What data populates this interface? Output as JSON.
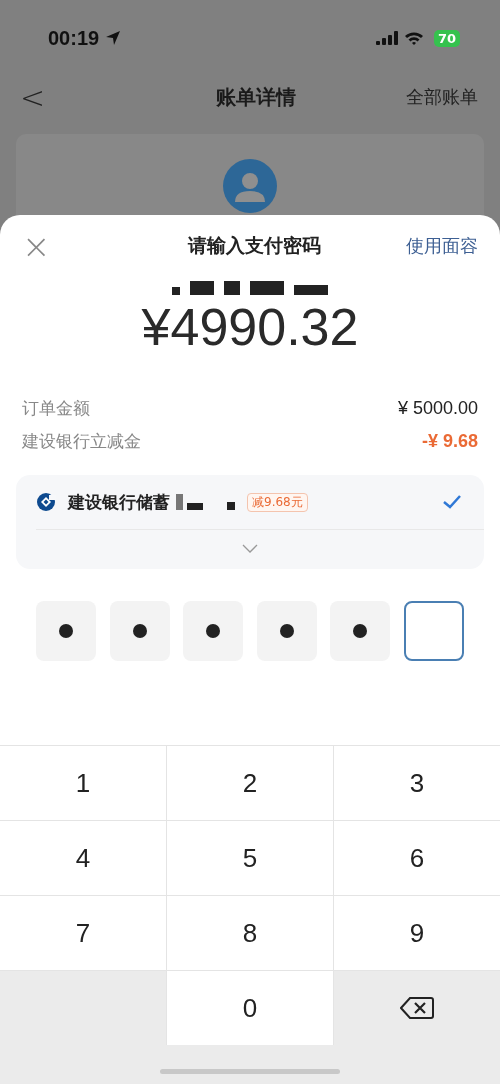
{
  "status_bar": {
    "time": "00:19",
    "battery": "70"
  },
  "nav": {
    "back": "<",
    "title": "账单详情",
    "right": "全部账单"
  },
  "sheet": {
    "close": "×",
    "title": "请输入支付密码",
    "face_id": "使用面容",
    "amount": "¥4990.32",
    "lines": [
      {
        "label": "订单金额",
        "value": "¥ 5000.00",
        "kind": "normal"
      },
      {
        "label": "建设银行立减金",
        "value": "-¥ 9.68",
        "kind": "discount"
      }
    ],
    "payment": {
      "name": "建设银行储蓄",
      "tag": "减9.68元",
      "checked": true
    },
    "pin": [
      {
        "filled": true,
        "selected": false
      },
      {
        "filled": true,
        "selected": false
      },
      {
        "filled": true,
        "selected": false
      },
      {
        "filled": true,
        "selected": false
      },
      {
        "filled": true,
        "selected": false
      },
      {
        "filled": false,
        "selected": true
      }
    ]
  },
  "keypad": [
    {
      "kind": "digit",
      "label": "1"
    },
    {
      "kind": "digit",
      "label": "2"
    },
    {
      "kind": "digit",
      "label": "3"
    },
    {
      "kind": "digit",
      "label": "4"
    },
    {
      "kind": "digit",
      "label": "5"
    },
    {
      "kind": "digit",
      "label": "6"
    },
    {
      "kind": "digit",
      "label": "7"
    },
    {
      "kind": "digit",
      "label": "8"
    },
    {
      "kind": "digit",
      "label": "9"
    },
    {
      "kind": "blank"
    },
    {
      "kind": "digit",
      "label": "0"
    },
    {
      "kind": "delete"
    }
  ]
}
